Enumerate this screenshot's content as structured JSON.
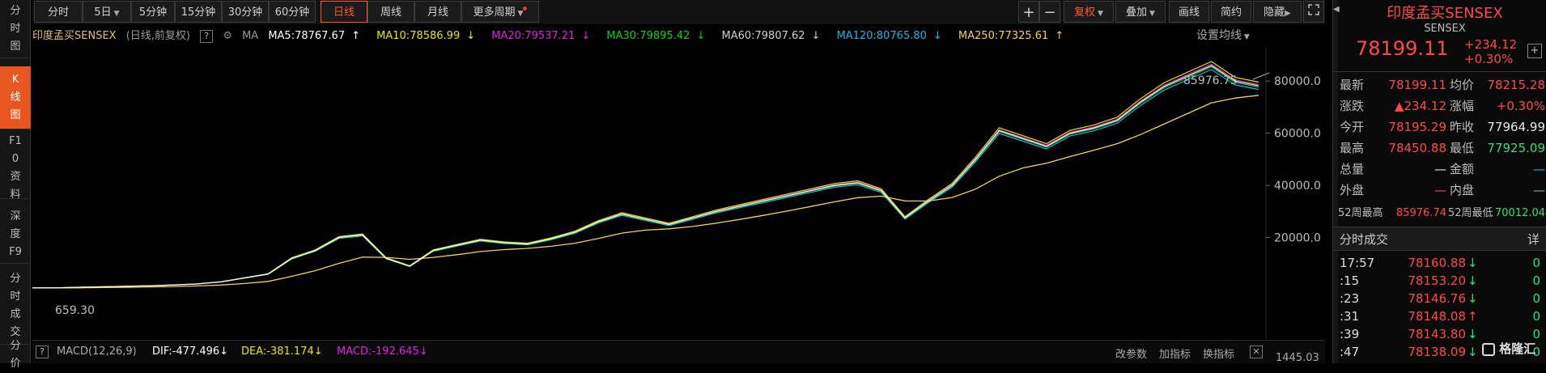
{
  "colors": {
    "up": "#ff4a4a",
    "down": "#2de07a",
    "accent": "#e8561f",
    "ma5": "#ffffff",
    "ma10": "#e7e600",
    "ma20": "#e020e0",
    "ma30": "#10d010",
    "ma60": "#cfcfcf",
    "ma120": "#1fb5e6",
    "ma250": "#f0d060"
  },
  "leftnav": [
    {
      "label": "分时图"
    },
    {
      "label": "K线图",
      "active": true
    },
    {
      "label": "F10资料"
    },
    {
      "label": "深度F9"
    },
    {
      "label": "分时成交"
    },
    {
      "label": "分价"
    }
  ],
  "toolbar": {
    "periods": [
      "分时",
      "5日",
      "5分钟",
      "15分钟",
      "30分钟",
      "60分钟",
      "日线",
      "周线",
      "月线",
      "更多周期"
    ],
    "active_period": "日线",
    "right_buttons": [
      "+",
      "−",
      "复权",
      "叠加",
      "画线",
      "简约",
      "隐藏"
    ],
    "expand_icon": "expand-icon"
  },
  "maline": {
    "title": "印度孟买SENSEX",
    "subtitle": "(日线,前复权)",
    "ma_label": "MA",
    "ma5": "MA5:78767.67",
    "ma10": "MA10:78586.99",
    "ma20": "MA20:79537.21",
    "ma30": "MA30:79895.42",
    "ma60": "MA60:79807.62",
    "ma120": "MA120:80765.80",
    "ma250": "MA250:77325.61",
    "ma5_arrow": "↑",
    "ma10_arrow": "↓",
    "ma20_arrow": "↓",
    "ma30_arrow": "↓",
    "ma60_arrow": "↓",
    "ma120_arrow": "↓",
    "ma250_arrow": "↑",
    "settings": "设置均线"
  },
  "chart_data": {
    "type": "line",
    "series": [
      {
        "values": [
          659.3,
          700,
          900,
          1100,
          1300,
          1500,
          1800,
          2200,
          3000,
          4500,
          6000,
          12000,
          15000,
          20000,
          21000,
          12000,
          9000,
          15000,
          17000,
          19000,
          18000,
          17500,
          19500,
          22000,
          26000,
          29000,
          27000,
          25000,
          27500,
          30000,
          32000,
          34000,
          36000,
          38000,
          40000,
          41000,
          38000,
          27500,
          34000,
          40000,
          50000,
          61000,
          58000,
          55000,
          60000,
          62000,
          65000,
          72000,
          78000,
          82000,
          85976.75,
          80000,
          78199.11
        ]
      }
    ],
    "y_ticks": [
      "80000.0",
      "60000.0",
      "40000.0",
      "20000.0"
    ],
    "ylim": [
      0,
      90000
    ],
    "annotations": {
      "low": "659.30",
      "high": "85976.75"
    },
    "grid": false
  },
  "macd": {
    "label": "MACD(12,26,9)",
    "dif": "DIF:-477.496",
    "dif_arrow": "↓",
    "dea": "DEA:-381.174",
    "dea_arrow": "↓",
    "macd": "MACD:-192.645",
    "macd_arrow": "↓",
    "btn1": "改参数",
    "btn2": "加指标",
    "btn3": "换指标",
    "right_value": "1445.03"
  },
  "quote": {
    "name": "印度孟买SENSEX",
    "code": "SENSEX",
    "price": "78199.11",
    "change": "+234.12",
    "change_pct": "+0.30%",
    "rows": [
      {
        "l1": "最新",
        "v1": "78199.11",
        "l2": "均价",
        "v2": "78215.28"
      },
      {
        "l1": "涨跌",
        "v1": "▲234.12",
        "l2": "涨幅",
        "v2": "+0.30%"
      },
      {
        "l1": "今开",
        "v1": "78195.29",
        "l2": "昨收",
        "v2": "77964.99"
      },
      {
        "l1": "最高",
        "v1": "78450.88",
        "l2": "最低",
        "v2": "77925.09"
      },
      {
        "l1": "总量",
        "v1": "—",
        "l2": "金额",
        "v2": "—"
      },
      {
        "l1": "外盘",
        "v1": "—",
        "l2": "内盘",
        "v2": "—"
      }
    ],
    "w52_high_label": "52周最高",
    "w52_high": "85976.74",
    "w52_low_label": "52周最低",
    "w52_low": "70012.04",
    "ticks_title": "分时成交",
    "ticks_detail": "详",
    "ticks": [
      {
        "t": "17:57",
        "p": "78160.88",
        "a": "↓",
        "v": "0"
      },
      {
        "t": ":15",
        "p": "78153.20",
        "a": "↓",
        "v": "0"
      },
      {
        "t": ":23",
        "p": "78146.76",
        "a": "↓",
        "v": "0"
      },
      {
        "t": ":31",
        "p": "78148.08",
        "a": "↑",
        "v": "0"
      },
      {
        "t": ":39",
        "p": "78143.80",
        "a": "↓",
        "v": "0"
      },
      {
        "t": ":47",
        "p": "78138.09",
        "a": "↓",
        "v": "0"
      }
    ],
    "watermark": "格隆汇"
  }
}
